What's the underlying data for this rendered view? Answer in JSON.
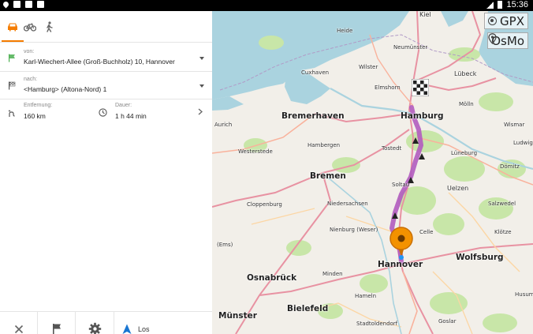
{
  "status_bar": {
    "time": "15:36"
  },
  "modes": [
    {
      "name": "car",
      "active": true
    },
    {
      "name": "bicycle",
      "active": false
    },
    {
      "name": "pedestrian",
      "active": false
    }
  ],
  "route": {
    "from_label": "von:",
    "from_value": "Karl-Wiechert-Allee (Groß-Buchholz) 10, Hannover",
    "to_label": "nach:",
    "to_value": "<Hamburg> (Altona-Nord) 1",
    "distance_label": "Entfernung:",
    "distance_value": "160 km",
    "duration_label": "Dauer:",
    "duration_value": "1 h 44 min"
  },
  "bottom_bar": {
    "go_label": "Los"
  },
  "map": {
    "overlay_gpx": "GPX",
    "overlay_osmo": "OsMo",
    "route_color": "#b15bbf",
    "marker_color": "#f39200",
    "water_color": "#aad3df",
    "forest_color": "#c8e6a8",
    "cities": [
      {
        "name": "Kiel",
        "size": "med"
      },
      {
        "name": "Heide",
        "size": "sm"
      },
      {
        "name": "Neumünster",
        "size": "sm"
      },
      {
        "name": "Cuxhaven",
        "size": "sm"
      },
      {
        "name": "Wilster",
        "size": "sm"
      },
      {
        "name": "Lübeck",
        "size": "med"
      },
      {
        "name": "Elmshorn",
        "size": "sm"
      },
      {
        "name": "Bremerhaven",
        "size": "big"
      },
      {
        "name": "Hamburg",
        "size": "big"
      },
      {
        "name": "Mölln",
        "size": "sm"
      },
      {
        "name": "Aurich",
        "size": "sm"
      },
      {
        "name": "Wismar",
        "size": "sm"
      },
      {
        "name": "Westerstede",
        "size": "sm"
      },
      {
        "name": "Hambergen",
        "size": "sm"
      },
      {
        "name": "Tostedt",
        "size": "sm"
      },
      {
        "name": "Lüneburg",
        "size": "sm"
      },
      {
        "name": "Ludwig",
        "size": "sm"
      },
      {
        "name": "Bremen",
        "size": "big"
      },
      {
        "name": "Dömitz",
        "size": "sm"
      },
      {
        "name": "Soltau",
        "size": "sm"
      },
      {
        "name": "Uelzen",
        "size": "med"
      },
      {
        "name": "Cloppenburg",
        "size": "sm"
      },
      {
        "name": "Niedersachsen",
        "size": "sm"
      },
      {
        "name": "Salzwedel",
        "size": "sm"
      },
      {
        "name": "Nienburg (Weser)",
        "size": "sm"
      },
      {
        "name": "Celle",
        "size": "sm"
      },
      {
        "name": "Klötze",
        "size": "sm"
      },
      {
        "name": "(Ems)",
        "size": "sm"
      },
      {
        "name": "Hannover",
        "size": "big"
      },
      {
        "name": "Wolfsburg",
        "size": "big"
      },
      {
        "name": "Osnabrück",
        "size": "big"
      },
      {
        "name": "Minden",
        "size": "sm"
      },
      {
        "name": "Hameln",
        "size": "sm"
      },
      {
        "name": "Münster",
        "size": "big"
      },
      {
        "name": "Bielefeld",
        "size": "big"
      },
      {
        "name": "Goslar",
        "size": "sm"
      },
      {
        "name": "Stadtoldendorf",
        "size": "sm"
      },
      {
        "name": "Husum",
        "size": "sm"
      }
    ]
  }
}
